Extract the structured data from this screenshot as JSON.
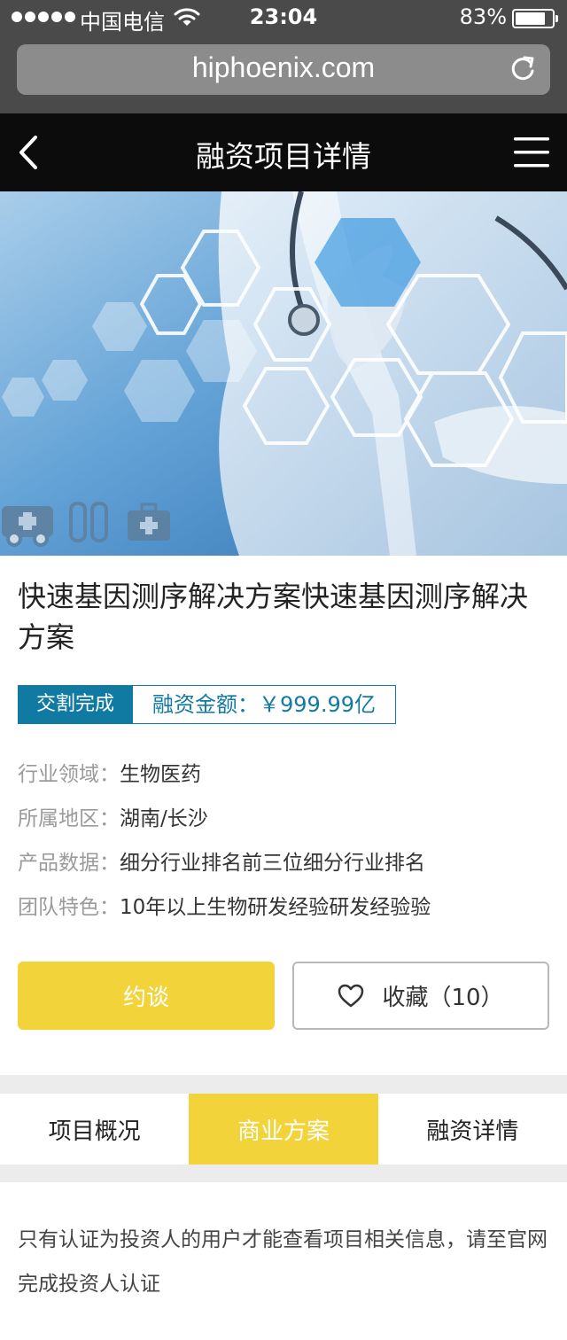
{
  "status_bar": {
    "carrier": "中国电信",
    "time": "23:04",
    "battery": "83%",
    "battery_level": 0.83
  },
  "browser": {
    "url": "hiphoenix.com"
  },
  "header": {
    "title": "融资项目详情"
  },
  "project": {
    "title": "快速基因测序解决方案快速基因测序解决方案",
    "status_tag": "交割完成",
    "amount_label": "融资金额：",
    "amount_value": "￥999.99亿",
    "info": [
      {
        "label": "行业领域：",
        "value": "生物医药"
      },
      {
        "label": "所属地区：",
        "value": "湖南/长沙"
      },
      {
        "label": "产品数据：",
        "value": "细分行业排名前三位细分行业排名"
      },
      {
        "label": "团队特色：",
        "value": "10年以上生物研发经验研发经验验"
      }
    ]
  },
  "actions": {
    "appointment": "约谈",
    "favorite": "收藏（10）"
  },
  "tabs": [
    {
      "label": "项目概况",
      "active": false
    },
    {
      "label": "商业方案",
      "active": true
    },
    {
      "label": "融资详情",
      "active": false
    }
  ],
  "notice": "只有认证为投资人的用户才能查看项目相关信息，请至官网完成投资人认证",
  "colors": {
    "accent_yellow": "#f3d33a",
    "accent_blue": "#117aa3",
    "header_bg": "#0c0c0c"
  }
}
